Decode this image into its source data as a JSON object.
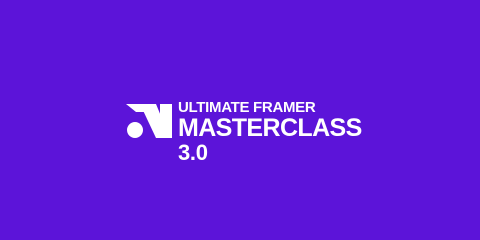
{
  "brand": {
    "background_color": "#5c14d9",
    "text_color": "#ffffff",
    "logo_icon": "ultimate-framer-logo-icon"
  },
  "title": {
    "line1": "ULTIMATE FRAMER",
    "line2": "MASTERCLASS",
    "line3": "3.0"
  }
}
